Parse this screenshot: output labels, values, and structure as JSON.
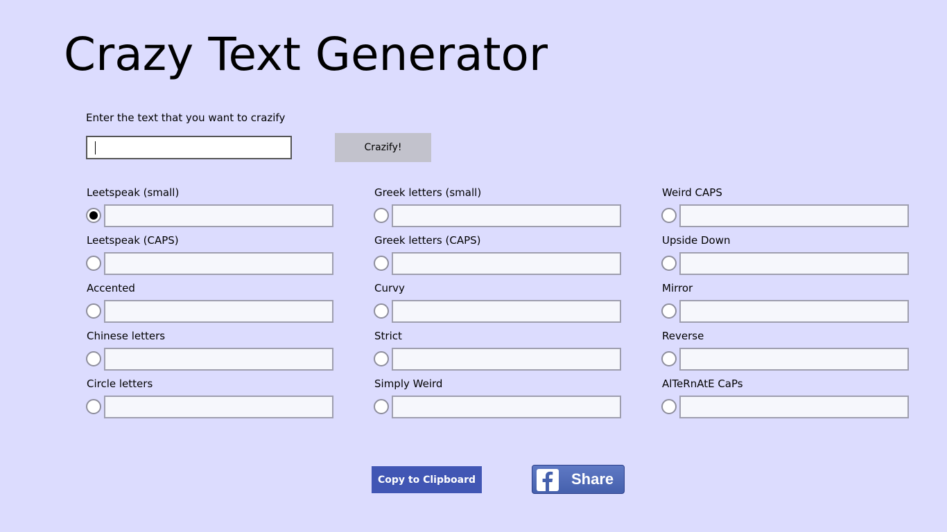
{
  "app": {
    "title": "Crazy Text Generator"
  },
  "input": {
    "label": "Enter the text that you want to crazify",
    "value": "",
    "button_label": "Crazify!"
  },
  "columns": [
    {
      "options": [
        {
          "label": "Leetspeak (small)",
          "value": "",
          "selected": true
        },
        {
          "label": "Leetspeak (CAPS)",
          "value": "",
          "selected": false
        },
        {
          "label": "Accented",
          "value": "",
          "selected": false
        },
        {
          "label": "Chinese letters",
          "value": "",
          "selected": false
        },
        {
          "label": "Circle letters",
          "value": "",
          "selected": false
        }
      ]
    },
    {
      "options": [
        {
          "label": "Greek letters (small)",
          "value": "",
          "selected": false
        },
        {
          "label": "Greek letters (CAPS)",
          "value": "",
          "selected": false
        },
        {
          "label": "Curvy",
          "value": "",
          "selected": false
        },
        {
          "label": "Strict",
          "value": "",
          "selected": false
        },
        {
          "label": "Simply Weird",
          "value": "",
          "selected": false
        }
      ]
    },
    {
      "options": [
        {
          "label": "Weird CAPS",
          "value": "",
          "selected": false
        },
        {
          "label": "Upside Down",
          "value": "",
          "selected": false
        },
        {
          "label": "Mirror",
          "value": "",
          "selected": false
        },
        {
          "label": "Reverse",
          "value": "",
          "selected": false
        },
        {
          "label": "AlTeRnAtE CaPs",
          "value": "",
          "selected": false
        }
      ]
    }
  ],
  "actions": {
    "copy_label": "Copy to Clipboard",
    "share_label": "Share"
  },
  "colors": {
    "background": "#dcdcfe",
    "copy_button": "#4156b4",
    "facebook_blue": "#4560ad",
    "crazify_button": "#c2c2cc"
  },
  "icons": {
    "share_logo": "facebook-f-icon"
  }
}
